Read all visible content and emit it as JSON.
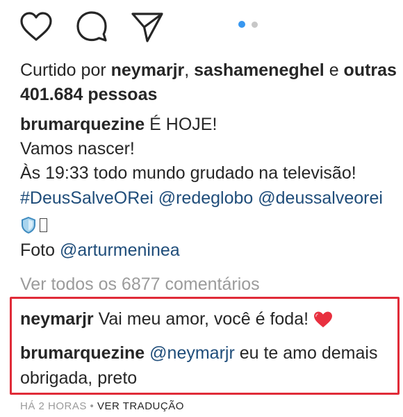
{
  "actions": {
    "like_icon": "heart-icon",
    "comment_icon": "comment-icon",
    "share_icon": "send-icon",
    "carousel": {
      "count": 2,
      "active": 1,
      "active_color": "#3897f0",
      "inactive_color": "#c7c7c7"
    }
  },
  "likes": {
    "prefix": "Curtido por ",
    "user1": "neymarjr",
    "sep": ", ",
    "user2": "sashameneghel",
    "connector": " e ",
    "others": "outras",
    "count": "401.684 pessoas"
  },
  "caption": {
    "username": "brumarquezine",
    "line1": " É HOJE!",
    "line2": "Vamos nascer!",
    "line3": "Às 19:33 todo mundo grudado na televisão!",
    "hashtag": "#DeusSalveORei",
    "mention1": "@redeglobo",
    "mention2": "@deussalveorei",
    "emoji_icon": "shield-emoji-icon",
    "photo_prefix": "Foto ",
    "photo_mention": "@arturmeninea"
  },
  "view_comments": "Ver todos os 6877 comentários",
  "comments": [
    {
      "username": "neymarjr",
      "text": " Vai meu amor, você é foda!",
      "emoji_icon": "red-heart-emoji-icon"
    },
    {
      "username": "brumarquezine",
      "mention": "@neymarjr",
      "text": " eu te amo demais",
      "text2": "obrigada, preto"
    }
  ],
  "footer": {
    "time": "HÁ 2 HORAS",
    "sep": " • ",
    "translate": "VER TRADUÇÃO"
  },
  "colors": {
    "link": "#1f4d7a",
    "highlight_border": "#e02b38",
    "muted": "#9b9b9b",
    "heart": "#ed4956"
  }
}
